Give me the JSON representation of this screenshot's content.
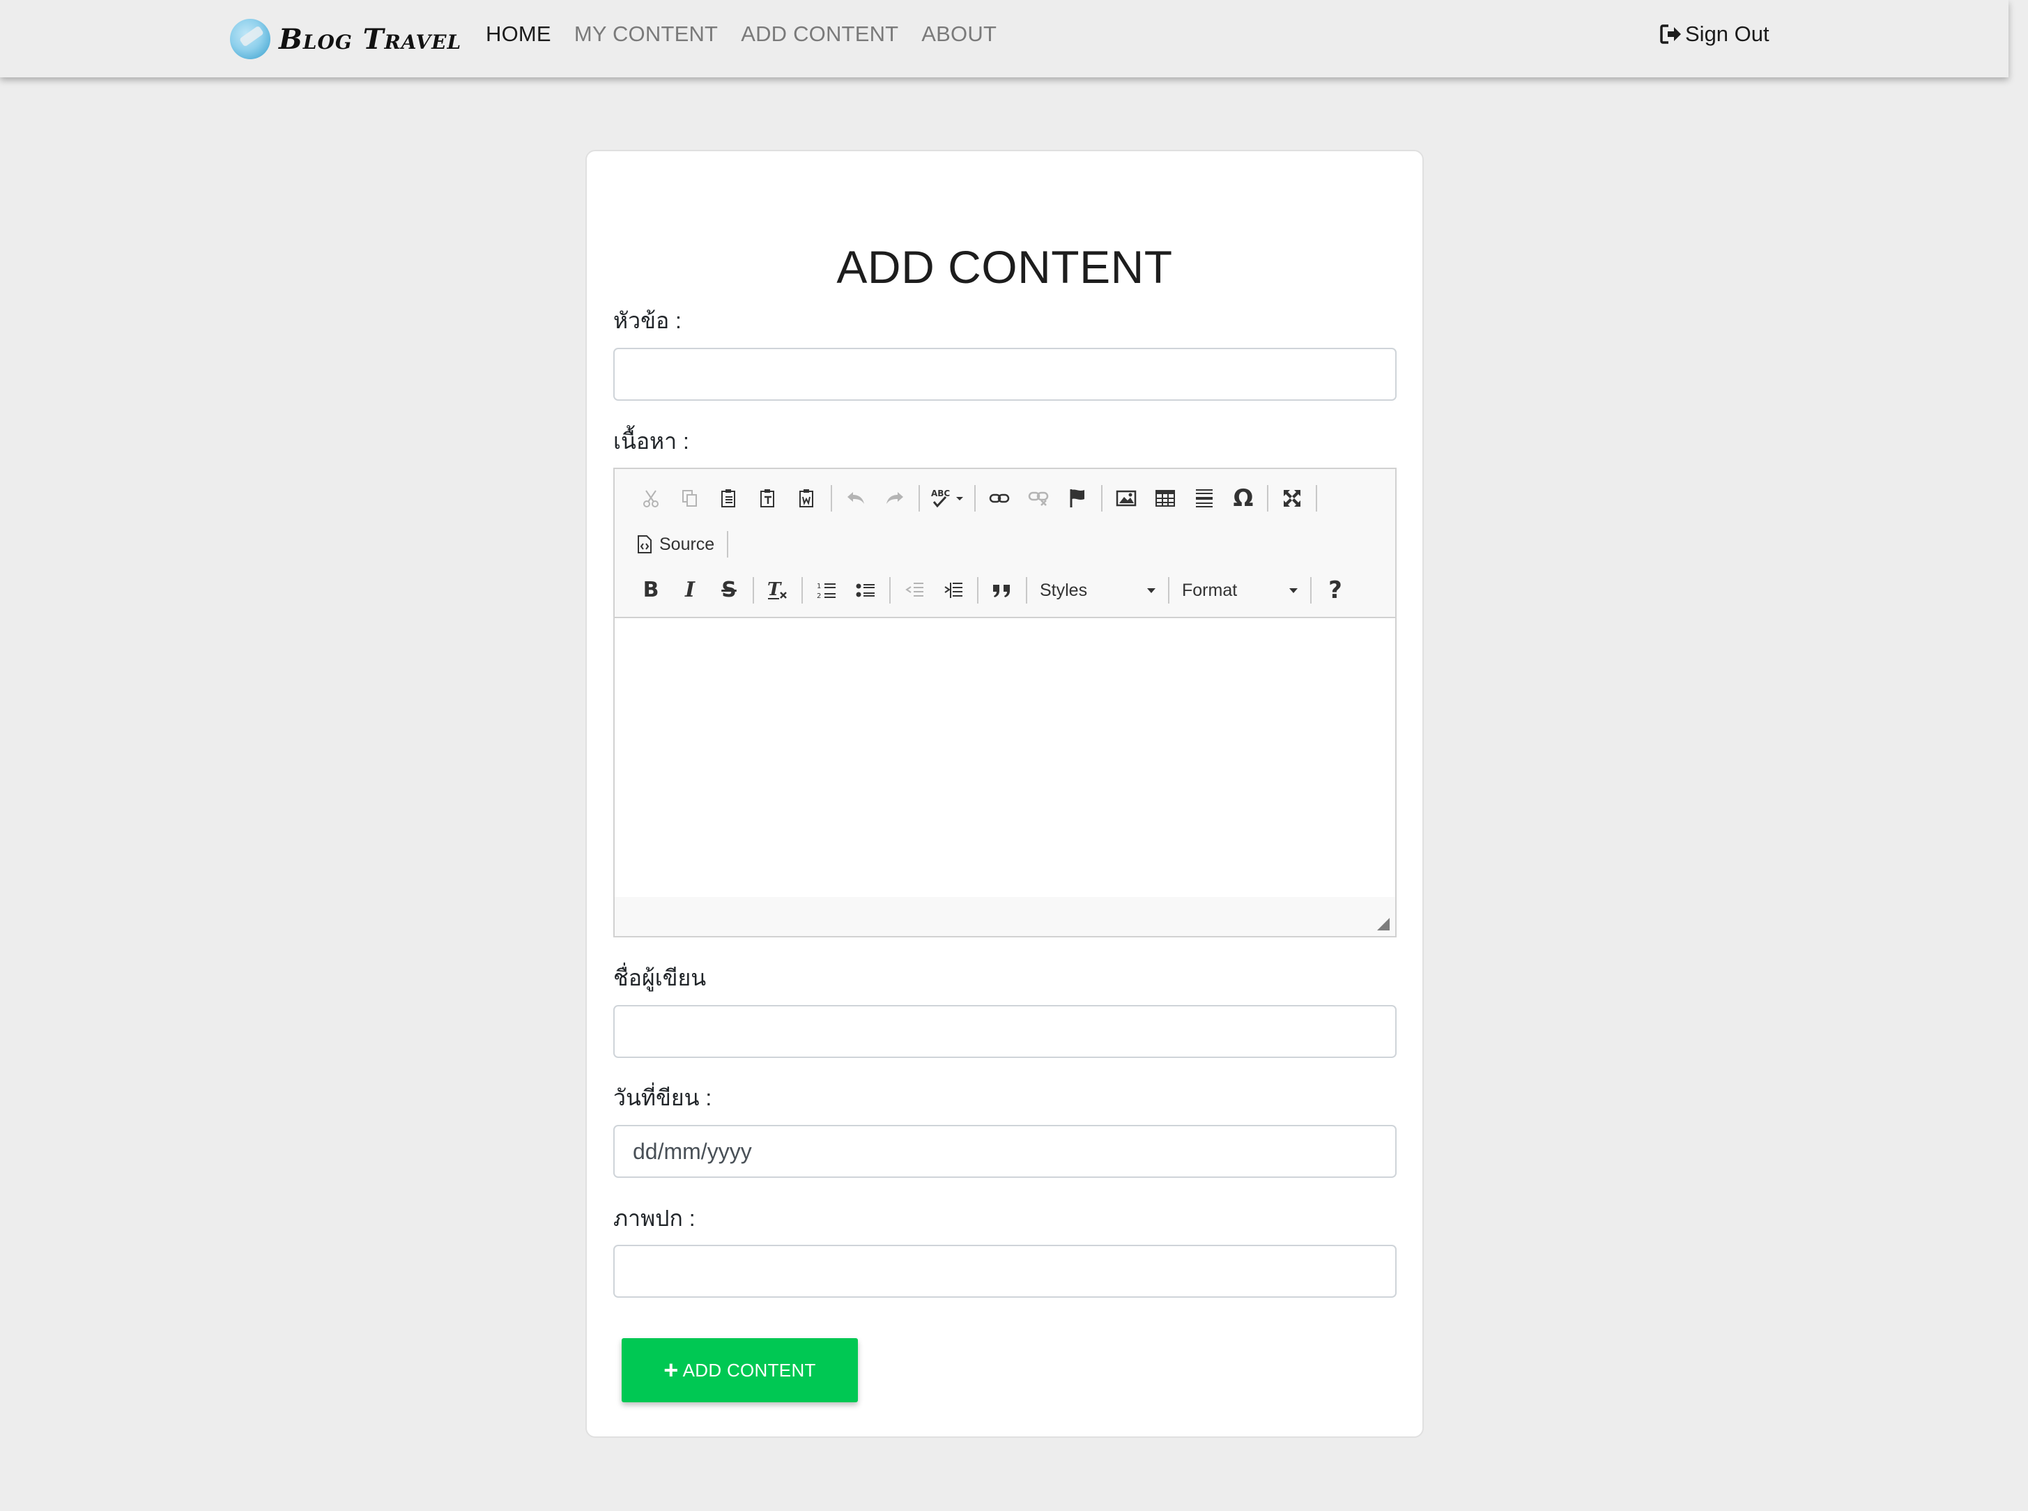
{
  "navbar": {
    "brand": "Blog Travel",
    "links": [
      {
        "label": "HOME",
        "active": true
      },
      {
        "label": "MY CONTENT",
        "active": false
      },
      {
        "label": "ADD CONTENT",
        "active": false
      },
      {
        "label": "ABOUT",
        "active": false
      }
    ],
    "sign_out": "Sign Out"
  },
  "form": {
    "title": "ADD CONTENT",
    "topic_label": "หัวข้อ :",
    "topic_value": "",
    "content_label": "เนื้อหา :",
    "author_label": "ชื่อผู้เขียน",
    "author_value": "",
    "date_label": "วันที่ขียน :",
    "date_placeholder": "dd/mm/yyyy",
    "cover_label": "ภาพปก :",
    "cover_value": "",
    "submit_label": "ADD CONTENT"
  },
  "editor": {
    "source_label": "Source",
    "styles_label": "Styles",
    "format_label": "Format",
    "help_label": "?",
    "body_text": ""
  },
  "colors": {
    "page_bg": "#ededed",
    "submit_bg": "#00c853",
    "nav_active": "#1b1b1b",
    "nav_inactive": "#7a7a7a"
  }
}
